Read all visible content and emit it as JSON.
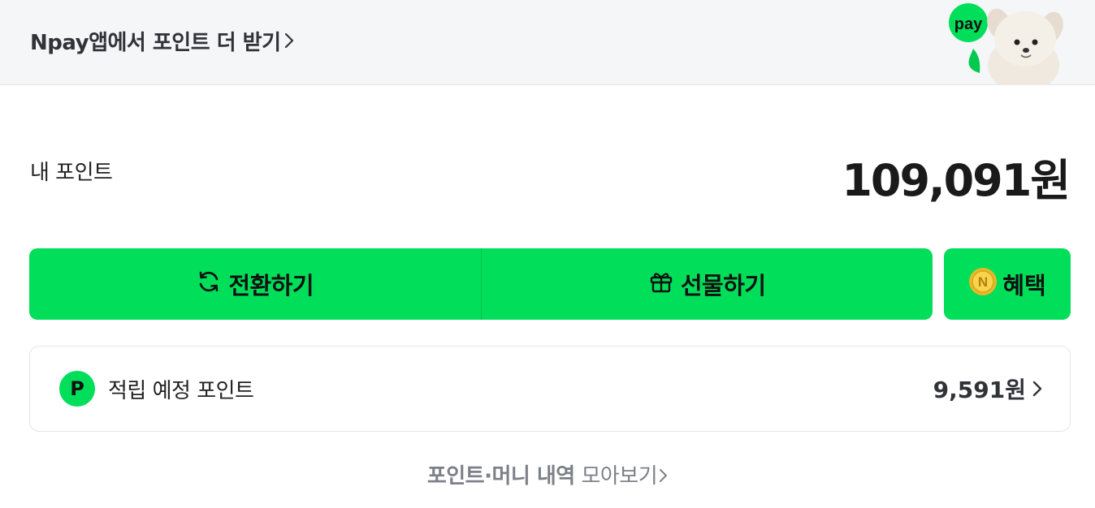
{
  "banner": {
    "link_text": "Npay앱에서 포인트 더 받기",
    "badge_text": "pay"
  },
  "points": {
    "label": "내 포인트",
    "value": "109,091원"
  },
  "actions": {
    "convert_label": "전환하기",
    "gift_label": "선물하기",
    "benefit_label": "혜택"
  },
  "pending": {
    "badge": "P",
    "label": "적립 예정 포인트",
    "value": "9,591원"
  },
  "history": {
    "bold_text": "포인트·머니 내역",
    "text": " 모아보기"
  },
  "colors": {
    "accent": "#00de5a",
    "banner_bg": "#f5f6f8"
  }
}
